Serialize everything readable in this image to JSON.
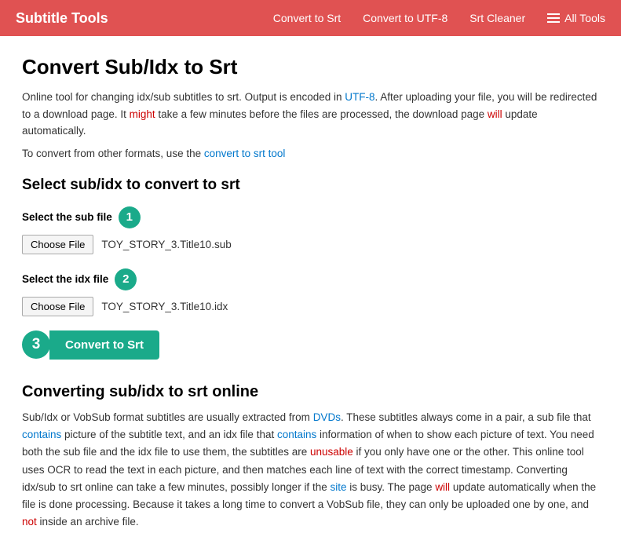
{
  "nav": {
    "brand": "Subtitle Tools",
    "links": [
      {
        "label": "Convert to Srt",
        "id": "convert-to-srt"
      },
      {
        "label": "Convert to UTF-8",
        "id": "convert-to-utf8"
      },
      {
        "label": "Srt Cleaner",
        "id": "srt-cleaner"
      },
      {
        "label": "All Tools",
        "id": "all-tools"
      }
    ]
  },
  "page": {
    "title": "Convert Sub/Idx to Srt",
    "description_part1": "Online tool for changing idx/sub subtitles to srt. Output is encoded in UTF-8. After uploading your file, you will be redirected to a download page. It might take a few minutes before the files are processed, the download page will update automatically.",
    "convert_link_text": "To convert from other formats, use the",
    "convert_link_anchor": "convert to srt tool",
    "section_title": "Select sub/idx to convert to srt",
    "sub_file_label": "Select the sub file",
    "sub_file_name": "TOY_STORY_3.Title10.sub",
    "idx_file_label": "Select the idx file",
    "idx_file_name": "TOY_STORY_3.Title10.idx",
    "choose_file_label": "Choose File",
    "convert_btn_label": "Convert to Srt",
    "lower_title": "Converting sub/idx to srt online",
    "lower_description": "Sub/Idx or VobSub format subtitles are usually extracted from DVDs. These subtitles always come in a pair, a sub file that contains picture of the subtitle text, and an idx file that contains information of when to show each picture of text. You need both the sub file and the idx file to use them, the subtitles are unusable if you only have one or the other. This online tool uses OCR to read the text in each picture, and then matches each line of text with the correct timestamp. Converting idx/sub to srt online can take a few minutes, possibly longer if the site is busy. The page will update automatically when the file is done processing. Because it takes a long time to convert a VobSub file, they can only be uploaded one by one, and not inside an archive file.",
    "step1": "1",
    "step2": "2",
    "step3": "3"
  }
}
